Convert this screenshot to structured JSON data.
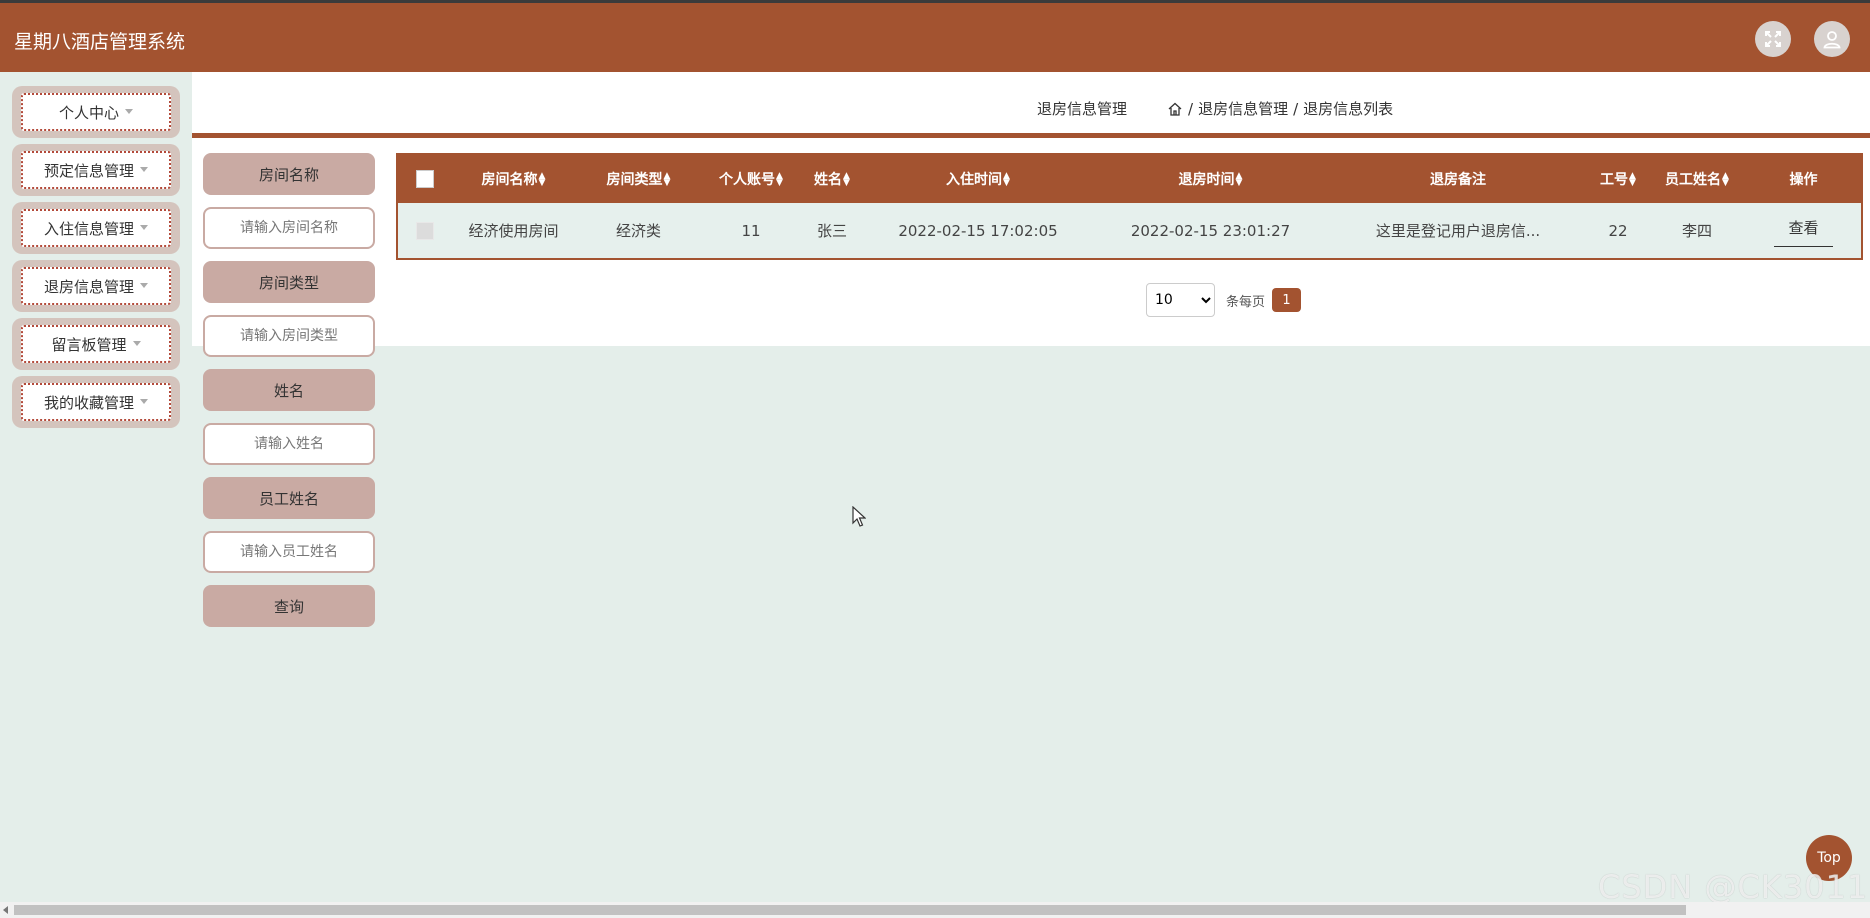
{
  "app": {
    "title": "星期八酒店管理系统"
  },
  "header": {
    "fullscreen_icon": "expand-icon",
    "user_icon": "user-icon"
  },
  "sidebar": {
    "items": [
      {
        "label": "个人中心"
      },
      {
        "label": "预定信息管理"
      },
      {
        "label": "入住信息管理"
      },
      {
        "label": "退房信息管理"
      },
      {
        "label": "留言板管理"
      },
      {
        "label": "我的收藏管理"
      }
    ]
  },
  "page": {
    "title": "退房信息管理",
    "breadcrumb": {
      "sep": "/",
      "level1": "退房信息管理",
      "level2": "退房信息列表"
    }
  },
  "search": {
    "room_name_label": "房间名称",
    "room_name_placeholder": "请输入房间名称",
    "room_type_label": "房间类型",
    "room_type_placeholder": "请输入房间类型",
    "name_label": "姓名",
    "name_placeholder": "请输入姓名",
    "staff_name_label": "员工姓名",
    "staff_name_placeholder": "请输入员工姓名",
    "query_label": "查询"
  },
  "table": {
    "columns": [
      "房间名称",
      "房间类型",
      "个人账号",
      "姓名",
      "入住时间",
      "退房时间",
      "退房备注",
      "工号",
      "员工姓名",
      "操作"
    ],
    "rows": [
      {
        "room_name": "经济使用房间",
        "room_type": "经济类",
        "account": "11",
        "name": "张三",
        "checkin_time": "2022-02-15 17:02:05",
        "checkout_time": "2022-02-15 23:01:27",
        "remark": "这里是登记用户退房信...",
        "staff_no": "22",
        "staff_name": "李四",
        "action": "查看"
      }
    ]
  },
  "pager": {
    "page_size": "10",
    "page_size_options": [
      "10"
    ],
    "per_page_label": "条每页",
    "current_page": "1"
  },
  "top_button": "Top",
  "watermark": "CSDN @CK3011",
  "colors": {
    "brand": "#a35330",
    "background": "#e4eeea",
    "label_bg": "#c9aaa3"
  }
}
